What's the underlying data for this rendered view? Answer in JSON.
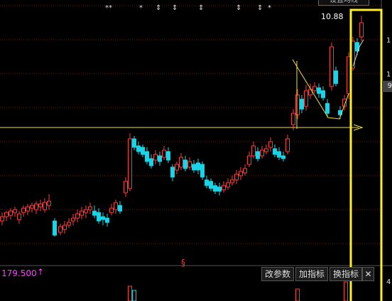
{
  "window": {
    "settings_button": "设置均线"
  },
  "chart": {
    "current_price": "10.88",
    "right_axis_ticks": [
      "1",
      "1",
      "9",
      "4"
    ],
    "top_markers": [
      "**",
      "*",
      "⇕",
      "⇕",
      "⇕",
      "⇕",
      "⇕",
      "*"
    ],
    "event_sign": "§",
    "colors": {
      "up": "#ff3a3a",
      "down": "#18d4e6",
      "annotation": "#f0e040",
      "grid": "#7a1515"
    }
  },
  "indicator": {
    "value": "179.500",
    "arrow": "↑",
    "buttons": {
      "modify": "改参数",
      "add": "加指标",
      "switch": "换指标",
      "close": "✕"
    }
  }
}
